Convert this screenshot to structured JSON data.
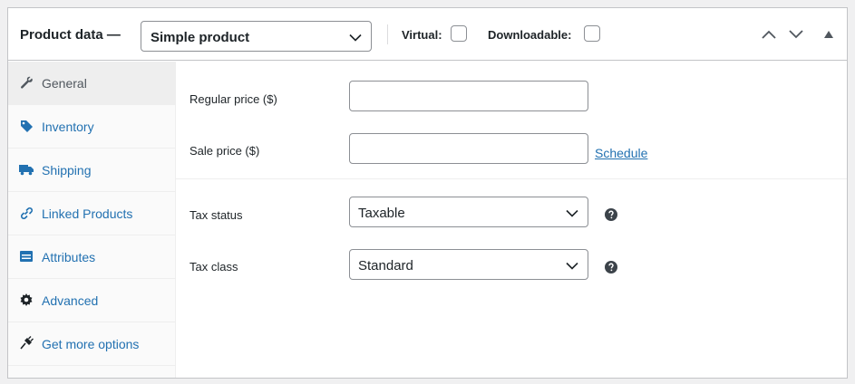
{
  "header": {
    "title": "Product data —",
    "product_type": "Simple product",
    "virtual_label": "Virtual:",
    "downloadable_label": "Downloadable:",
    "virtual_checked": false,
    "downloadable_checked": false
  },
  "sidebar": {
    "active": "General",
    "items": [
      {
        "label": "General",
        "icon": "wrench-icon"
      },
      {
        "label": "Inventory",
        "icon": "tag-icon"
      },
      {
        "label": "Shipping",
        "icon": "truck-icon"
      },
      {
        "label": "Linked Products",
        "icon": "link-icon"
      },
      {
        "label": "Attributes",
        "icon": "list-table-icon"
      },
      {
        "label": "Advanced",
        "icon": "gear-icon"
      },
      {
        "label": "Get more options",
        "icon": "plugin-icon"
      }
    ]
  },
  "fields": {
    "regular_price_label": "Regular price ($)",
    "regular_price_value": "",
    "sale_price_label": "Sale price ($)",
    "sale_price_value": "",
    "schedule_link": "Schedule",
    "tax_status_label": "Tax status",
    "tax_status_value": "Taxable",
    "tax_class_label": "Tax class",
    "tax_class_value": "Standard"
  },
  "colors": {
    "link": "#2271b1",
    "border": "#8c8f94",
    "text": "#1d2327",
    "active_tab_bg": "#eeeeee"
  }
}
